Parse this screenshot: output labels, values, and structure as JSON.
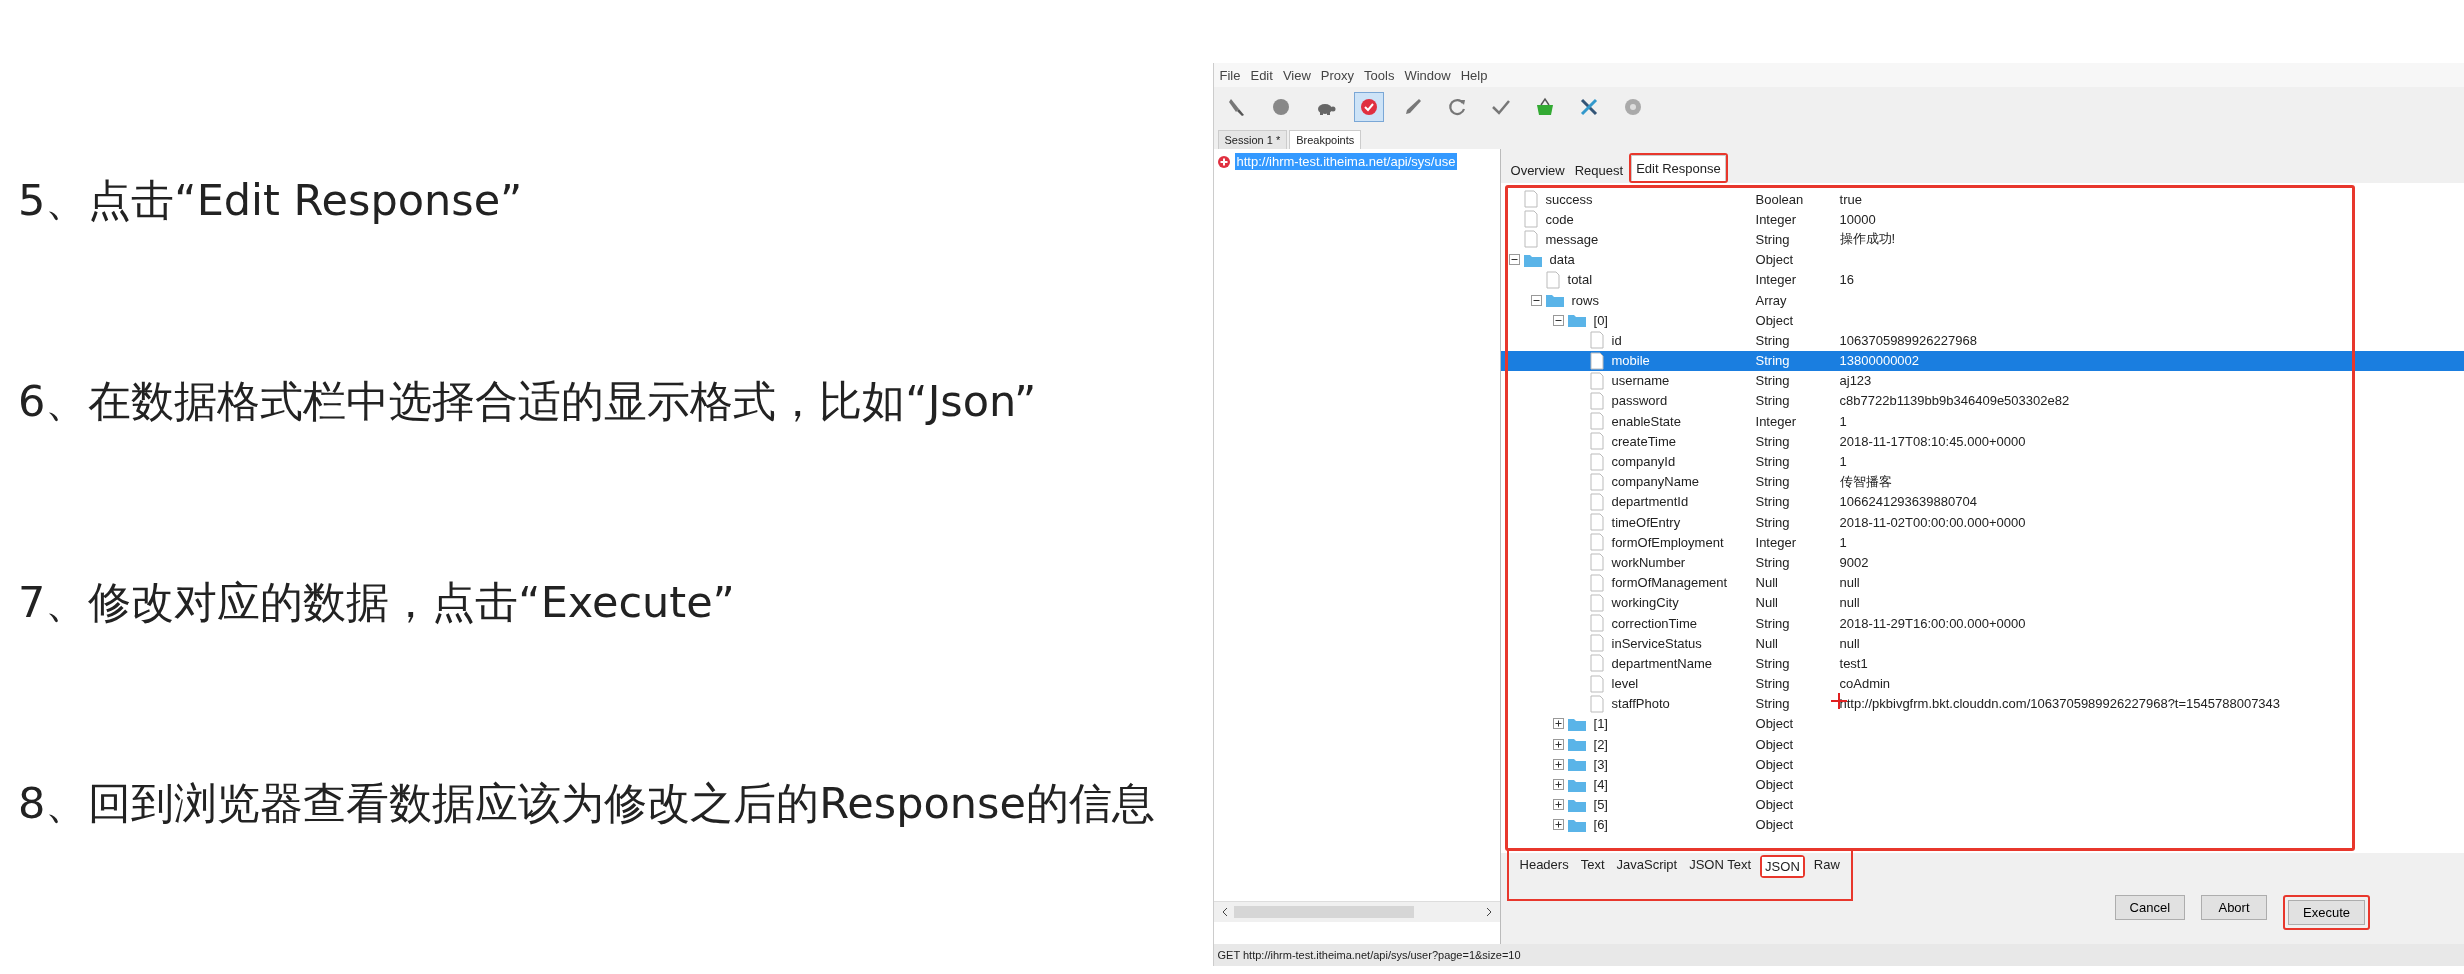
{
  "steps": [
    "5、点击“Edit Response”",
    "6、在数据格式栏中选择合适的显示格式，比如“Json”",
    "7、修改对应的数据，点击“Execute”",
    "8、回到浏览器查看数据应该为修改之后的Response的信息"
  ],
  "window": {
    "menu": [
      "File",
      "Edit",
      "View",
      "Proxy",
      "Tools",
      "Window",
      "Help"
    ],
    "toolbar": [
      {
        "kind": "broom",
        "selected": false
      },
      {
        "kind": "record",
        "selected": false
      },
      {
        "kind": "turtle",
        "selected": false
      },
      {
        "kind": "breakpoint",
        "selected": true
      },
      {
        "kind": "pen",
        "selected": false
      },
      {
        "kind": "refresh",
        "selected": false
      },
      {
        "kind": "check",
        "selected": false
      },
      {
        "kind": "basket",
        "selected": false
      },
      {
        "kind": "tools",
        "selected": false
      },
      {
        "kind": "settings",
        "selected": false
      }
    ],
    "session_tabs": [
      {
        "label": "Session 1 *",
        "selected": false
      },
      {
        "label": "Breakpoints",
        "selected": true
      }
    ],
    "requests": [
      {
        "url": "http://ihrm-test.itheima.net/api/sys/use",
        "selected": true
      }
    ],
    "tabs": [
      {
        "label": "Overview",
        "selected": false,
        "highlighted": false
      },
      {
        "label": "Request",
        "selected": false,
        "highlighted": false
      },
      {
        "label": "Edit Response",
        "selected": true,
        "highlighted": true
      }
    ],
    "tree_highlighted": true,
    "tree": [
      {
        "kind": "value",
        "name": "success",
        "type": "Boolean",
        "value": "true",
        "selected": false
      },
      {
        "kind": "value",
        "name": "code",
        "type": "Integer",
        "value": "10000",
        "selected": false
      },
      {
        "kind": "value",
        "name": "message",
        "type": "String",
        "value": "操作成功!",
        "selected": false
      },
      {
        "kind": "folder",
        "name": "data",
        "type": "Object",
        "expanded": true,
        "selected": false,
        "children": [
          {
            "kind": "value",
            "name": "total",
            "type": "Integer",
            "value": "16",
            "selected": false
          },
          {
            "kind": "folder",
            "name": "rows",
            "type": "Array",
            "expanded": true,
            "selected": false,
            "children": [
              {
                "kind": "folder",
                "name": "[0]",
                "type": "Object",
                "expanded": true,
                "selected": false,
                "children": [
                  {
                    "kind": "value",
                    "name": "id",
                    "type": "String",
                    "value": "1063705989926227968",
                    "selected": false
                  },
                  {
                    "kind": "value",
                    "name": "mobile",
                    "type": "String",
                    "value": "13800000002",
                    "selected": true
                  },
                  {
                    "kind": "value",
                    "name": "username",
                    "type": "String",
                    "value": "aj123",
                    "selected": false
                  },
                  {
                    "kind": "value",
                    "name": "password",
                    "type": "String",
                    "value": "c8b7722b1139bb9b346409e503302e82",
                    "selected": false
                  },
                  {
                    "kind": "value",
                    "name": "enableState",
                    "type": "Integer",
                    "value": "1",
                    "selected": false
                  },
                  {
                    "kind": "value",
                    "name": "createTime",
                    "type": "String",
                    "value": "2018-11-17T08:10:45.000+0000",
                    "selected": false
                  },
                  {
                    "kind": "value",
                    "name": "companyId",
                    "type": "String",
                    "value": "1",
                    "selected": false
                  },
                  {
                    "kind": "value",
                    "name": "companyName",
                    "type": "String",
                    "value": "传智播客",
                    "selected": false
                  },
                  {
                    "kind": "value",
                    "name": "departmentId",
                    "type": "String",
                    "value": "1066241293639880704",
                    "selected": false
                  },
                  {
                    "kind": "value",
                    "name": "timeOfEntry",
                    "type": "String",
                    "value": "2018-11-02T00:00:00.000+0000",
                    "selected": false
                  },
                  {
                    "kind": "value",
                    "name": "formOfEmployment",
                    "type": "Integer",
                    "value": "1",
                    "selected": false
                  },
                  {
                    "kind": "value",
                    "name": "workNumber",
                    "type": "String",
                    "value": "9002",
                    "selected": false
                  },
                  {
                    "kind": "value",
                    "name": "formOfManagement",
                    "type": "Null",
                    "value": "null",
                    "selected": false
                  },
                  {
                    "kind": "value",
                    "name": "workingCity",
                    "type": "Null",
                    "value": "null",
                    "selected": false
                  },
                  {
                    "kind": "value",
                    "name": "correctionTime",
                    "type": "String",
                    "value": "2018-11-29T16:00:00.000+0000",
                    "selected": false
                  },
                  {
                    "kind": "value",
                    "name": "inServiceStatus",
                    "type": "Null",
                    "value": "null",
                    "selected": false
                  },
                  {
                    "kind": "value",
                    "name": "departmentName",
                    "type": "String",
                    "value": "test1",
                    "selected": false
                  },
                  {
                    "kind": "value",
                    "name": "level",
                    "type": "String",
                    "value": "coAdmin",
                    "selected": false
                  },
                  {
                    "kind": "value",
                    "name": "staffPhoto",
                    "type": "String",
                    "value": "http://pkbivgfrm.bkt.clouddn.com/1063705989926227968?t=1545788007343",
                    "selected": false
                  }
                ]
              },
              {
                "kind": "folder",
                "name": "[1]",
                "type": "Object",
                "expanded": false,
                "selected": false
              },
              {
                "kind": "folder",
                "name": "[2]",
                "type": "Object",
                "expanded": false,
                "selected": false
              },
              {
                "kind": "folder",
                "name": "[3]",
                "type": "Object",
                "expanded": false,
                "selected": false
              },
              {
                "kind": "folder",
                "name": "[4]",
                "type": "Object",
                "expanded": false,
                "selected": false
              },
              {
                "kind": "folder",
                "name": "[5]",
                "type": "Object",
                "expanded": false,
                "selected": false
              },
              {
                "kind": "folder",
                "name": "[6]",
                "type": "Object",
                "expanded": false,
                "selected": false
              }
            ]
          }
        ]
      }
    ],
    "format_tabs_highlighted": true,
    "format_tabs": [
      {
        "label": "Headers",
        "selected": false,
        "highlighted": false
      },
      {
        "label": "Text",
        "selected": false,
        "highlighted": false
      },
      {
        "label": "JavaScript",
        "selected": false,
        "highlighted": false
      },
      {
        "label": "JSON Text",
        "selected": false,
        "highlighted": false
      },
      {
        "label": "JSON",
        "selected": true,
        "highlighted": true
      },
      {
        "label": "Raw",
        "selected": false,
        "highlighted": false
      }
    ],
    "buttons": [
      {
        "label": "Cancel",
        "highlighted": false
      },
      {
        "label": "Abort",
        "highlighted": false
      },
      {
        "label": "Execute",
        "highlighted": true
      }
    ],
    "status_bar": "GET http://ihrm-test.itheima.net/api/sys/user?page=1&size=10"
  }
}
